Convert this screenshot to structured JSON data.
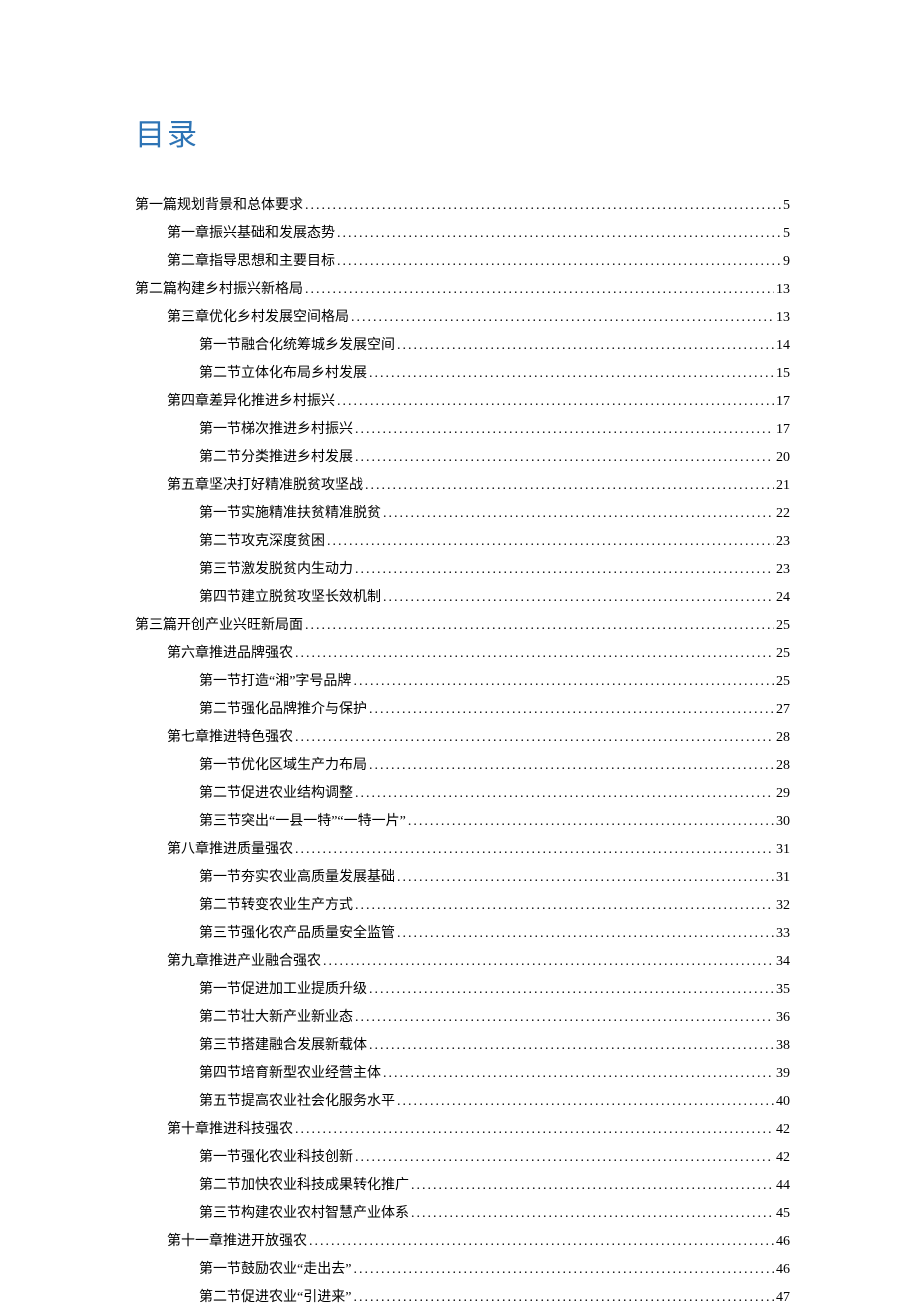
{
  "title": "目录",
  "entries": [
    {
      "level": 0,
      "label": "第一篇规划背景和总体要求",
      "page": "5"
    },
    {
      "level": 1,
      "label": "第一章振兴基础和发展态势",
      "page": "5"
    },
    {
      "level": 1,
      "label": "第二章指导思想和主要目标",
      "page": "9"
    },
    {
      "level": 0,
      "label": "第二篇构建乡村振兴新格局",
      "page": "13"
    },
    {
      "level": 1,
      "label": "第三章优化乡村发展空间格局",
      "page": "13"
    },
    {
      "level": 2,
      "label": "第一节融合化统筹城乡发展空间",
      "page": "14"
    },
    {
      "level": 2,
      "label": "第二节立体化布局乡村发展",
      "page": "15"
    },
    {
      "level": 1,
      "label": "第四章差异化推进乡村振兴",
      "page": "17"
    },
    {
      "level": 2,
      "label": "第一节梯次推进乡村振兴",
      "page": "17"
    },
    {
      "level": 2,
      "label": "第二节分类推进乡村发展",
      "page": "20"
    },
    {
      "level": 1,
      "label": "第五章坚决打好精准脱贫攻坚战",
      "page": "21"
    },
    {
      "level": 2,
      "label": "第一节实施精准扶贫精准脱贫",
      "page": "22"
    },
    {
      "level": 2,
      "label": "第二节攻克深度贫困",
      "page": "23"
    },
    {
      "level": 2,
      "label": "第三节激发脱贫内生动力",
      "page": "23"
    },
    {
      "level": 2,
      "label": "第四节建立脱贫攻坚长效机制",
      "page": "24"
    },
    {
      "level": 0,
      "label": "第三篇开创产业兴旺新局面",
      "page": "25"
    },
    {
      "level": 1,
      "label": "第六章推进品牌强农",
      "page": "25"
    },
    {
      "level": 2,
      "label": "第一节打造“湘”字号品牌",
      "page": "25"
    },
    {
      "level": 2,
      "label": "第二节强化品牌推介与保护",
      "page": "27"
    },
    {
      "level": 1,
      "label": "第七章推进特色强农",
      "page": "28"
    },
    {
      "level": 2,
      "label": "第一节优化区域生产力布局",
      "page": "28"
    },
    {
      "level": 2,
      "label": "第二节促进农业结构调整",
      "page": "29"
    },
    {
      "level": 2,
      "label": "第三节突出“一县一特”“一特一片”",
      "page": "30"
    },
    {
      "level": 1,
      "label": "第八章推进质量强农",
      "page": "31"
    },
    {
      "level": 2,
      "label": "第一节夯实农业高质量发展基础",
      "page": "31"
    },
    {
      "level": 2,
      "label": "第二节转变农业生产方式",
      "page": "32"
    },
    {
      "level": 2,
      "label": "第三节强化农产品质量安全监管",
      "page": "33"
    },
    {
      "level": 1,
      "label": "第九章推进产业融合强农",
      "page": "34"
    },
    {
      "level": 2,
      "label": "第一节促进加工业提质升级",
      "page": "35"
    },
    {
      "level": 2,
      "label": "第二节壮大新产业新业态",
      "page": "36"
    },
    {
      "level": 2,
      "label": "第三节搭建融合发展新载体",
      "page": "38"
    },
    {
      "level": 2,
      "label": "第四节培育新型农业经营主体",
      "page": "39"
    },
    {
      "level": 2,
      "label": "第五节提高农业社会化服务水平",
      "page": "40"
    },
    {
      "level": 1,
      "label": "第十章推进科技强农",
      "page": "42"
    },
    {
      "level": 2,
      "label": "第一节强化农业科技创新",
      "page": "42"
    },
    {
      "level": 2,
      "label": "第二节加快农业科技成果转化推广",
      "page": "44"
    },
    {
      "level": 2,
      "label": "第三节构建农业农村智慧产业体系",
      "page": "45"
    },
    {
      "level": 1,
      "label": "第十一章推进开放强农",
      "page": "46"
    },
    {
      "level": 2,
      "label": "第一节鼓励农业“走出去”",
      "page": "46"
    },
    {
      "level": 2,
      "label": "第二节促进农业“引进来”",
      "page": "47"
    }
  ]
}
